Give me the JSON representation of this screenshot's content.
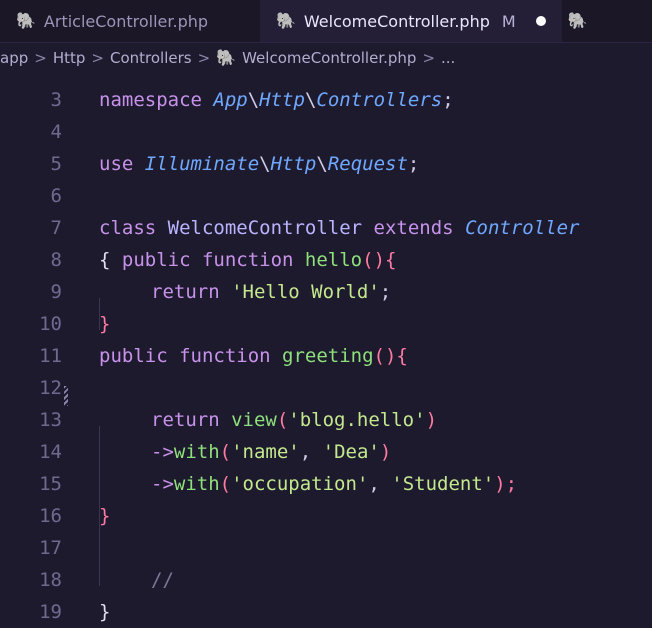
{
  "tabs": [
    {
      "label": "ArticleController.php",
      "active": false,
      "icon": "php-elephant-icon"
    },
    {
      "label": "WelcomeController.php",
      "active": true,
      "modified": "M",
      "icon": "php-elephant-icon"
    }
  ],
  "breadcrumb": {
    "parts": [
      "app",
      "Http",
      "Controllers",
      "WelcomeController.php",
      "..."
    ],
    "separator": ">"
  },
  "lines": [
    {
      "n": "3",
      "tokens": [
        {
          "t": "namespace ",
          "c": "kw"
        },
        {
          "t": "App",
          "c": "ns"
        },
        {
          "t": "\\",
          "c": "punc"
        },
        {
          "t": "Http",
          "c": "ns"
        },
        {
          "t": "\\",
          "c": "punc"
        },
        {
          "t": "Controllers",
          "c": "ns"
        },
        {
          "t": ";",
          "c": "punc"
        }
      ]
    },
    {
      "n": "4",
      "tokens": []
    },
    {
      "n": "5",
      "tokens": [
        {
          "t": "use ",
          "c": "kw"
        },
        {
          "t": "Illuminate",
          "c": "ns"
        },
        {
          "t": "\\",
          "c": "punc"
        },
        {
          "t": "Http",
          "c": "ns"
        },
        {
          "t": "\\",
          "c": "punc"
        },
        {
          "t": "Request",
          "c": "ns"
        },
        {
          "t": ";",
          "c": "punc"
        }
      ]
    },
    {
      "n": "6",
      "tokens": []
    },
    {
      "n": "7",
      "tokens": [
        {
          "t": "class ",
          "c": "kw"
        },
        {
          "t": "WelcomeController ",
          "c": "cls"
        },
        {
          "t": "extends ",
          "c": "kw"
        },
        {
          "t": "Controller",
          "c": "ns"
        }
      ]
    },
    {
      "n": "8",
      "tokens": [
        {
          "t": "{ ",
          "c": "plain"
        },
        {
          "t": "public ",
          "c": "kw"
        },
        {
          "t": "function ",
          "c": "kw"
        },
        {
          "t": "hello",
          "c": "fn"
        },
        {
          "t": "(){",
          "c": "paren"
        }
      ]
    },
    {
      "n": "9",
      "indent": 1,
      "tokens": [
        {
          "t": "return ",
          "c": "kw"
        },
        {
          "t": "'Hello World'",
          "c": "str"
        },
        {
          "t": ";",
          "c": "punc"
        }
      ]
    },
    {
      "n": "10",
      "tokens": [
        {
          "t": "}",
          "c": "paren"
        }
      ]
    },
    {
      "n": "11",
      "tokens": [
        {
          "t": "public ",
          "c": "kw"
        },
        {
          "t": "function ",
          "c": "kw"
        },
        {
          "t": "greeting",
          "c": "fn"
        },
        {
          "t": "(){",
          "c": "paren"
        }
      ]
    },
    {
      "n": "12",
      "tokens": []
    },
    {
      "n": "13",
      "indent": 1,
      "tokens": [
        {
          "t": "return ",
          "c": "kw"
        },
        {
          "t": "view",
          "c": "fn"
        },
        {
          "t": "(",
          "c": "paren"
        },
        {
          "t": "'blog.hello'",
          "c": "str"
        },
        {
          "t": ")",
          "c": "paren"
        }
      ]
    },
    {
      "n": "14",
      "indent": 1,
      "tokens": [
        {
          "t": "->",
          "c": "kw"
        },
        {
          "t": "with",
          "c": "fn"
        },
        {
          "t": "(",
          "c": "paren"
        },
        {
          "t": "'name'",
          "c": "str"
        },
        {
          "t": ", ",
          "c": "punc"
        },
        {
          "t": "'Dea'",
          "c": "str"
        },
        {
          "t": ")",
          "c": "paren"
        }
      ]
    },
    {
      "n": "15",
      "indent": 1,
      "tokens": [
        {
          "t": "->",
          "c": "kw"
        },
        {
          "t": "with",
          "c": "fn"
        },
        {
          "t": "(",
          "c": "paren"
        },
        {
          "t": "'occupation'",
          "c": "str"
        },
        {
          "t": ", ",
          "c": "punc"
        },
        {
          "t": "'Student'",
          "c": "str"
        },
        {
          "t": ");",
          "c": "paren"
        }
      ]
    },
    {
      "n": "16",
      "tokens": [
        {
          "t": "}",
          "c": "paren"
        }
      ]
    },
    {
      "n": "17",
      "tokens": []
    },
    {
      "n": "18",
      "indent": 1,
      "tokens": [
        {
          "t": "//",
          "c": "cmt"
        }
      ]
    },
    {
      "n": "19",
      "tokens": [
        {
          "t": "}",
          "c": "plain"
        }
      ]
    }
  ]
}
